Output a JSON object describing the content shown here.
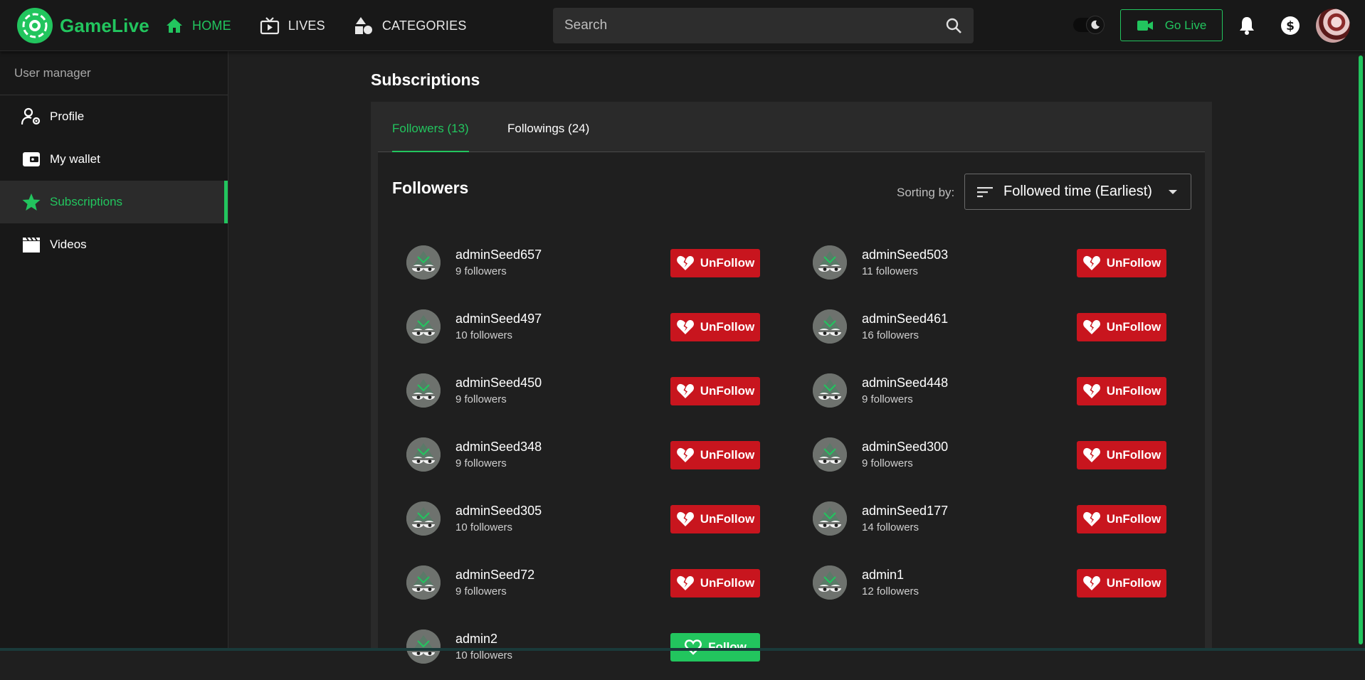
{
  "brand": {
    "name": "GameLive",
    "accent": "#22c55e"
  },
  "nav": [
    {
      "label": "HOME",
      "icon": "home-icon",
      "active": true
    },
    {
      "label": "LIVES",
      "icon": "tv-icon",
      "active": false
    },
    {
      "label": "CATEGORIES",
      "icon": "shapes-icon",
      "active": false
    }
  ],
  "search": {
    "placeholder": "Search",
    "value": ""
  },
  "header": {
    "go_live_label": "Go Live"
  },
  "sidebar": {
    "title": "User manager",
    "items": [
      {
        "label": "Profile",
        "icon": "user-gear-icon",
        "active": false
      },
      {
        "label": "My wallet",
        "icon": "wallet-icon",
        "active": false
      },
      {
        "label": "Subscriptions",
        "icon": "star-icon",
        "active": true
      },
      {
        "label": "Videos",
        "icon": "clapperboard-icon",
        "active": false
      }
    ]
  },
  "main": {
    "title": "Subscriptions",
    "tabs": [
      {
        "label": "Followers (13)",
        "active": true
      },
      {
        "label": "Followings (24)",
        "active": false
      }
    ],
    "panel_title": "Followers",
    "sort": {
      "label": "Sorting by:",
      "value": "Followed time (Earliest)"
    },
    "followers": [
      {
        "name": "adminSeed657",
        "count": "9 followers",
        "action": "UnFollow"
      },
      {
        "name": "adminSeed503",
        "count": "11 followers",
        "action": "UnFollow"
      },
      {
        "name": "adminSeed497",
        "count": "10 followers",
        "action": "UnFollow"
      },
      {
        "name": "adminSeed461",
        "count": "16 followers",
        "action": "UnFollow"
      },
      {
        "name": "adminSeed450",
        "count": "9 followers",
        "action": "UnFollow"
      },
      {
        "name": "adminSeed448",
        "count": "9 followers",
        "action": "UnFollow"
      },
      {
        "name": "adminSeed348",
        "count": "9 followers",
        "action": "UnFollow"
      },
      {
        "name": "adminSeed300",
        "count": "9 followers",
        "action": "UnFollow"
      },
      {
        "name": "adminSeed305",
        "count": "10 followers",
        "action": "UnFollow"
      },
      {
        "name": "adminSeed177",
        "count": "14 followers",
        "action": "UnFollow"
      },
      {
        "name": "adminSeed72",
        "count": "9 followers",
        "action": "UnFollow"
      },
      {
        "name": "admin1",
        "count": "12 followers",
        "action": "UnFollow"
      },
      {
        "name": "admin2",
        "count": "10 followers",
        "action": "Follow"
      }
    ]
  },
  "colors": {
    "unfollow": "#c8151e",
    "follow": "#22c55e"
  }
}
